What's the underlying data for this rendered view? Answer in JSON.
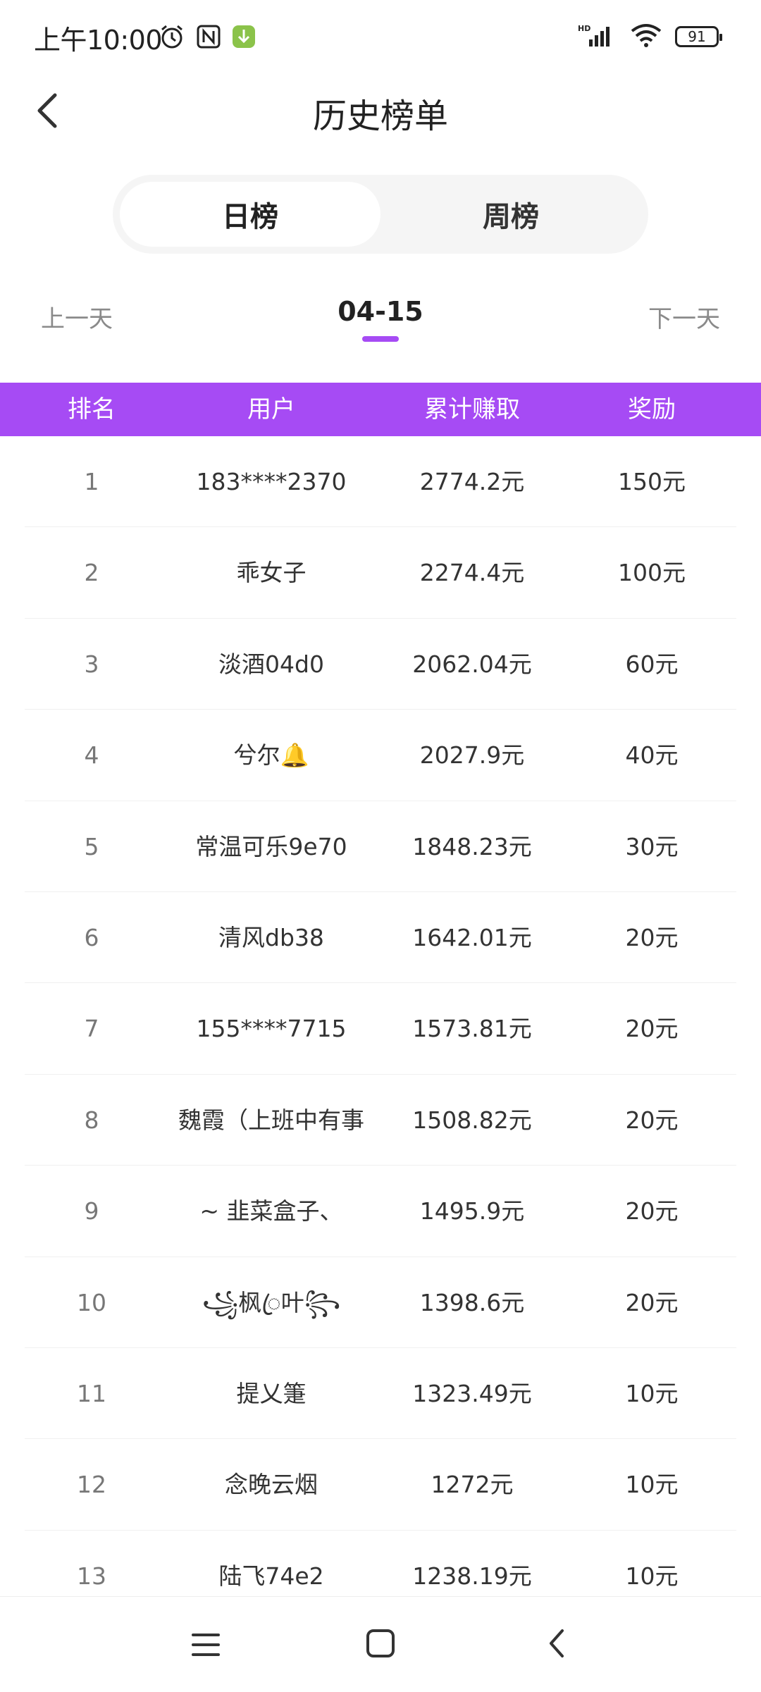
{
  "status_bar": {
    "time": "上午10:00",
    "battery": "91",
    "network": "HD"
  },
  "header": {
    "title": "历史榜单"
  },
  "tabs": [
    {
      "label": "日榜",
      "active": true
    },
    {
      "label": "周榜",
      "active": false
    }
  ],
  "date_nav": {
    "prev": "上一天",
    "current": "04-15",
    "next": "下一天"
  },
  "table": {
    "headers": [
      "排名",
      "用户",
      "累计赚取",
      "奖励"
    ],
    "rows": [
      {
        "rank": "1",
        "user": "183****2370",
        "earned": "2774.2元",
        "reward": "150元"
      },
      {
        "rank": "2",
        "user": "乖女子",
        "earned": "2274.4元",
        "reward": "100元"
      },
      {
        "rank": "3",
        "user": "淡酒04d0",
        "earned": "2062.04元",
        "reward": "60元"
      },
      {
        "rank": "4",
        "user": "兮尔🔔",
        "earned": "2027.9元",
        "reward": "40元"
      },
      {
        "rank": "5",
        "user": "常温可乐9e70",
        "earned": "1848.23元",
        "reward": "30元"
      },
      {
        "rank": "6",
        "user": "清风db38",
        "earned": "1642.01元",
        "reward": "20元"
      },
      {
        "rank": "7",
        "user": "155****7715",
        "earned": "1573.81元",
        "reward": "20元"
      },
      {
        "rank": "8",
        "user": "魏霞（上班中有事",
        "earned": "1508.82元",
        "reward": "20元"
      },
      {
        "rank": "9",
        "user": "~ 韭菜盒子、",
        "earned": "1495.9元",
        "reward": "20元"
      },
      {
        "rank": "10",
        "user": "꧁枫ꦿ叶꧂",
        "earned": "1398.6元",
        "reward": "20元"
      },
      {
        "rank": "11",
        "user": "提乂箑",
        "earned": "1323.49元",
        "reward": "10元"
      },
      {
        "rank": "12",
        "user": "念晚云烟",
        "earned": "1272元",
        "reward": "10元"
      },
      {
        "rank": "13",
        "user": "陆飞74e2",
        "earned": "1238.19元",
        "reward": "10元"
      }
    ]
  },
  "colors": {
    "accent": "#a64bf4"
  },
  "icons": {
    "back": "chevron-left-icon",
    "nav_menu": "menu-icon",
    "nav_home": "home-square-icon",
    "nav_back": "back-icon"
  }
}
